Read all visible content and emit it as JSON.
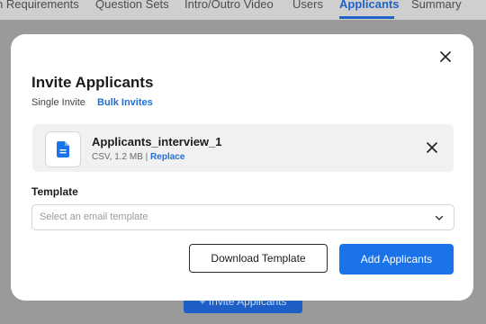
{
  "topnav": {
    "tabs": [
      {
        "label": "n Requirements"
      },
      {
        "label": "Question Sets"
      },
      {
        "label": "Intro/Outro Video"
      },
      {
        "label": "Users"
      },
      {
        "label": "Applicants",
        "active": true
      },
      {
        "label": "Summary"
      }
    ]
  },
  "background": {
    "invite_button_label": "+ Invite Applicants"
  },
  "modal": {
    "title": "Invite Applicants",
    "modes": {
      "single": "Single Invite",
      "bulk": "Bulk Invites"
    },
    "file": {
      "name": "Applicants_interview_1",
      "meta": "CSV, 1.2 MB |",
      "replace_label": "Replace",
      "icon": "document-icon"
    },
    "template": {
      "label": "Template",
      "placeholder": "Select an email template"
    },
    "actions": {
      "download_label": "Download Template",
      "add_label": "Add Applicants"
    }
  },
  "colors": {
    "accent": "#1a73e8",
    "link": "#1f6fd6",
    "overlay": "#9a9a9a"
  }
}
